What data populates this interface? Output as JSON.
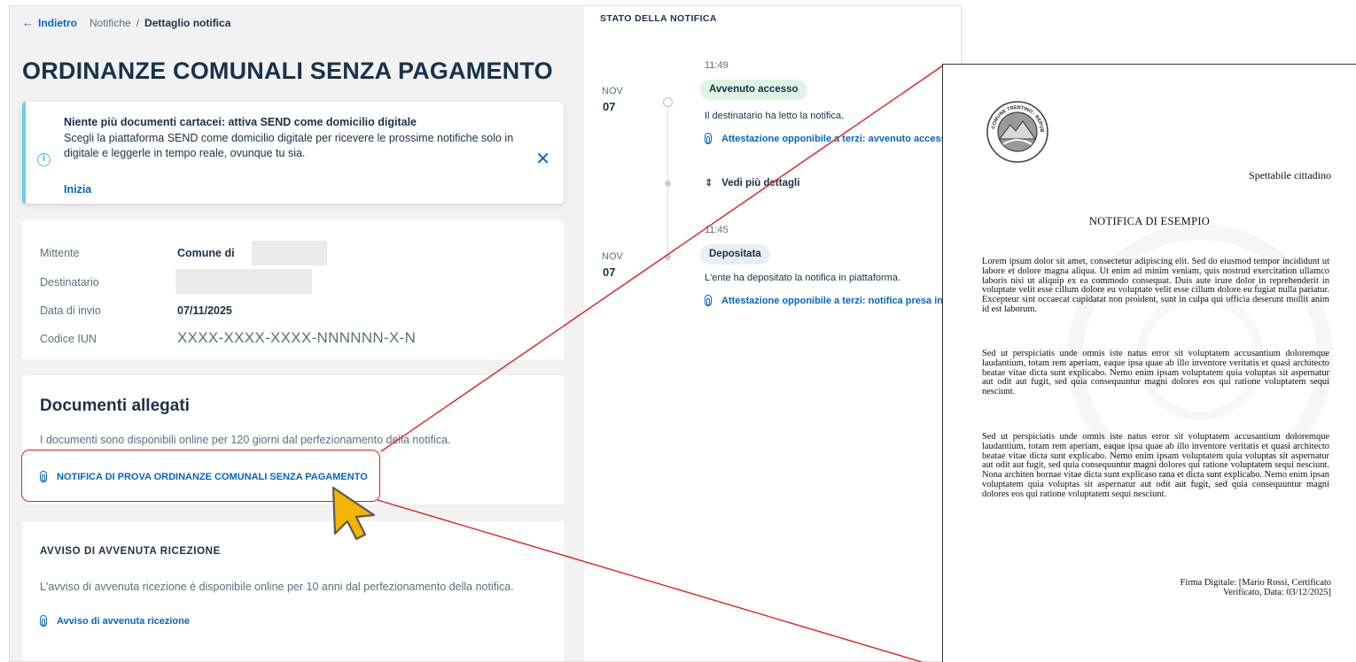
{
  "breadcrumb": {
    "back_label": "Indietro",
    "items": [
      "Notifiche"
    ],
    "current": "Dettaglio notifica"
  },
  "page_title": "ORDINANZE COMUNALI SENZA PAGAMENTO",
  "banner": {
    "title": "Niente più documenti cartacei: attiva SEND come domicilio digitale",
    "text": "Scegli la piattaforma SEND come domicilio digitale per ricevere le prossime notifiche solo in digitale e leggerle in tempo reale, ovunque tu sia.",
    "action_label": "Inizia"
  },
  "details": {
    "sender_label": "Mittente",
    "sender_value": "Comune di",
    "recipient_label": "Destinatario",
    "date_label": "Data di invio",
    "date_value": "07/11/2025",
    "iun_label": "Codice IUN",
    "iun_value": "XXXX-XXXX-XXXX-NNNNNN-X-N"
  },
  "documents": {
    "title": "Documenti allegati",
    "text": "I documenti sono disponibili online per 120 giorni dal perfezionamento della notifica.",
    "attachment_label": "NOTIFICA DI PROVA ORDINANZE COMUNALI SENZA PAGAMENTO"
  },
  "receipt": {
    "title": "AVVISO DI AVVENUTA RICEZIONE",
    "text": "L'avviso di avvenuta ricezione è disponibile online per 10 anni dal perfezionamento della notifica.",
    "link_label": "Avviso di avvenuta ricezione"
  },
  "timeline": {
    "heading": "STATO DELLA NOTIFICA",
    "show_more_label": "Vedi più dettagli",
    "events": [
      {
        "month": "NOV",
        "day": "07",
        "time": "11:49",
        "status": "Avvenuto accesso",
        "description": "Il destinatario ha letto la notifica.",
        "link": "Attestazione opponibile a terzi: avvenuto accesso"
      },
      {
        "month": "NOV",
        "day": "07",
        "time": "11:45",
        "status": "Depositata",
        "description": "L'ente ha depositato la notifica in piattaforma.",
        "link": "Attestazione opponibile a terzi: notifica presa in carico"
      }
    ]
  },
  "document_preview": {
    "logo_text": "COMUNE TRENTINO - REPUBBLICA ITALIANA",
    "greeting": "Spettabile cittadino",
    "title": "NOTIFICA DI ESEMPIO",
    "paragraphs": [
      "Lorem ipsum dolor sit amet, consectetur adipiscing elit. Sed do eiusmod tempor incididunt ut labore et dolore magna aliqua. Ut enim ad minim veniam, quis nostrud exercitation ullamco laboris nisi ut aliquip ex ea commodo consequat. Duis aute irure dolor in reprehenderit in voluptate velit esse cillum dolore eu voluptate velit esse cillum dolore eu fugiat nulla pariatur. Excepteur sint occaecat cupidatat non proident, sunt in culpa qui officia deserunt mollit anim id est laborum.",
      "Sed ut perspiciatis unde omnis iste natus error sit voluptatem accusantium doloremque laudantium, totam rem aperiam, eaque ipsa quae ab illo inventore veritatis et quasi architecto beatae vitae dicta sunt explicabo. Nemo enim ipsam voluptatem quia voluptas sit aspernatur aut odit aut fugit, sed quia consequuntur magni dolores eos qui ratione voluptatem sequi nesciunt.",
      "Sed ut perspiciatis unde omnis iste natus error sit voluptatem accusantium doloremque laudantium, totam rem aperiam, eaque ipsa quae ab illo inventore veritatis et quasi architecto beatae vitae dicta sunt explicabo. Nemo enim ipsam voluptatem quia voluptas sit aspernatur aut odit aut fugit, sed quia consequuntur magni dolores qui ratione voluptatem sequi nesciunt. Nona architen bornae vitae dicta sunt explicaso rana et dicta sunt explicabo. Nemo enim ipsan voluptatem quia voluptas sit aspernatur aut odit aut fugit, sed quia consequuntur magni dolores eos qui ratione voluptatem sequi nesciunt."
    ],
    "signature": "Firma Digitale: [Mario Rossi, Certificato Verificato, Data: 03/12/2025]"
  },
  "colors": {
    "primary": "#0066cc",
    "text_dark": "#17324d",
    "text_muted": "#5c6f82",
    "banner_accent": "#6bcfe8",
    "success_badge": "#dff4e2",
    "highlight": "#e02020",
    "cursor_fill": "#f4b400"
  },
  "icons": {
    "back": "arrow-left-icon",
    "info": "info-circle-icon",
    "close": "close-icon",
    "attachment": "paperclip-icon",
    "expand": "unfold-icon",
    "pointer": "mouse-pointer-icon"
  }
}
